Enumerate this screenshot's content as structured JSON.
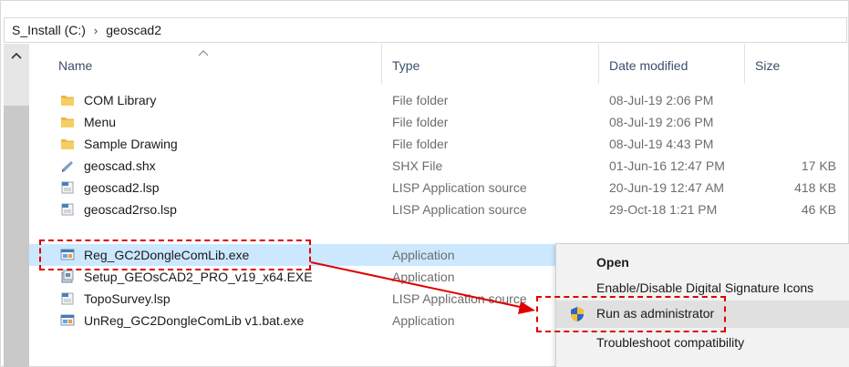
{
  "breadcrumb": {
    "items": [
      "S_Install (C:)",
      "geoscad2"
    ],
    "separator": "›"
  },
  "columns": {
    "name": "Name",
    "type": "Type",
    "date": "Date modified",
    "size": "Size"
  },
  "files": [
    {
      "name": "COM Library",
      "type": "File folder",
      "date": "08-Jul-19 2:06 PM",
      "size": "",
      "icon": "folder-icon"
    },
    {
      "name": "Menu",
      "type": "File folder",
      "date": "08-Jul-19 2:06 PM",
      "size": "",
      "icon": "folder-icon"
    },
    {
      "name": "Sample Drawing",
      "type": "File folder",
      "date": "08-Jul-19 4:43 PM",
      "size": "",
      "icon": "folder-icon"
    },
    {
      "name": "geoscad.shx",
      "type": "SHX File",
      "date": "01-Jun-16 12:47 PM",
      "size": "17 KB",
      "icon": "shx-file-icon"
    },
    {
      "name": "geoscad2.lsp",
      "type": "LISP Application source",
      "date": "20-Jun-19 12:47 AM",
      "size": "418 KB",
      "icon": "lsp-file-icon"
    },
    {
      "name": "geoscad2rso.lsp",
      "type": "LISP Application source",
      "date": "29-Oct-18 1:21 PM",
      "size": "46 KB",
      "icon": "lsp-file-icon"
    },
    {
      "name": "Reg_GC2DongleComLib.exe",
      "type": "Application",
      "date": "",
      "size": "",
      "icon": "exe-app-icon",
      "selected": true
    },
    {
      "name": "Setup_GEOsCAD2_PRO_v19_x64.EXE",
      "type": "Application",
      "date": "",
      "size": "",
      "icon": "setup-exe-icon"
    },
    {
      "name": "TopoSurvey.lsp",
      "type": "LISP Application source",
      "date": "",
      "size": "",
      "icon": "lsp-file-icon"
    },
    {
      "name": "UnReg_GC2DongleComLib v1.bat.exe",
      "type": "Application",
      "date": "",
      "size": "",
      "icon": "exe-app-icon"
    }
  ],
  "context_menu": {
    "items": [
      {
        "label": "Open",
        "bold": true
      },
      {
        "label": "Enable/Disable Digital Signature Icons"
      },
      {
        "label": "Run as administrator",
        "icon": "uac-shield-icon",
        "hover": true
      },
      {
        "label": "Troubleshoot compatibility"
      }
    ]
  },
  "colors": {
    "selection": "#cce8ff",
    "annotation": "#e00000",
    "header_text": "#3a4f6b",
    "muted_text": "#6d6d6d"
  }
}
